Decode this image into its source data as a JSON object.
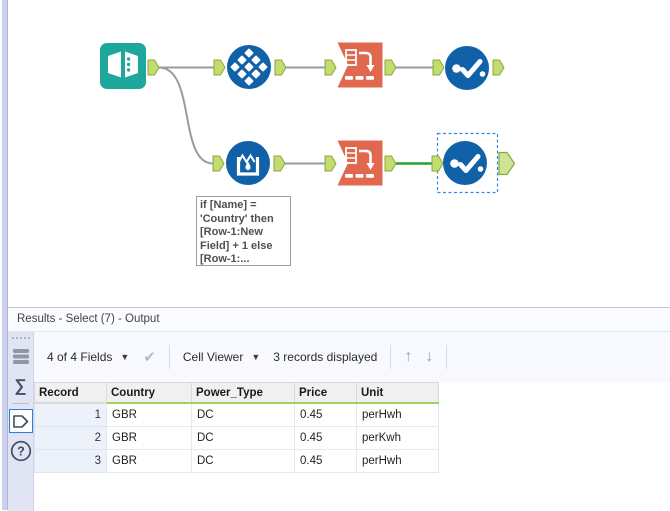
{
  "colors": {
    "tool_blue": "#1161a8",
    "tool_teal": "#1ea79b",
    "tool_orange": "#e0684e",
    "anchor_green": "#c3dc70",
    "anchor_border": "#8aa83e",
    "connection_gray": "#9b9b9b",
    "connection_green_selected": "#2e9e36",
    "selection_dash_blue": "#2f8ae0",
    "header_underline_green": "#9cd45f"
  },
  "icons": {
    "dropdown_caret": "▼",
    "apply_check": "✔",
    "up_arrow": "↑",
    "down_arrow": "↓",
    "sigma": "∑",
    "help": "?"
  },
  "canvas": {
    "tools": [
      {
        "id": "input-data",
        "icon": "open-book-icon",
        "color": "#1ea79b"
      },
      {
        "id": "select",
        "icon": "diamond-grid-icon",
        "color": "#1161a8"
      },
      {
        "id": "transpose-top",
        "icon": "table-rotate-arrow-icon",
        "color": "#e0684e"
      },
      {
        "id": "browse-top",
        "icon": "dot-checkmark-icon",
        "color": "#1161a8"
      },
      {
        "id": "multi-row-formula",
        "icon": "crown-droplet-icon",
        "color": "#1161a8"
      },
      {
        "id": "transpose-bottom",
        "icon": "table-rotate-arrow-icon",
        "color": "#e0684e"
      },
      {
        "id": "browse-bottom",
        "icon": "dot-checkmark-icon",
        "color": "#1161a8",
        "selected": true
      }
    ],
    "annotation_text": "if [Name] =\n'Country' then\n[Row-1:New\nField] + 1 else\n[Row-1:..."
  },
  "results": {
    "title": "Results - Select (7) - Output",
    "toolbar": {
      "fields_dropdown": "4 of 4 Fields",
      "cell_viewer_dropdown": "Cell Viewer",
      "records_displayed": "3 records displayed"
    },
    "table": {
      "columns": [
        "Record",
        "Country",
        "Power_Type",
        "Price",
        "Unit"
      ],
      "rows": [
        [
          "1",
          "GBR",
          "DC",
          "0.45",
          "perHwh"
        ],
        [
          "2",
          "GBR",
          "DC",
          "0.45",
          "perKwh"
        ],
        [
          "3",
          "GBR",
          "DC",
          "0.45",
          "perHwh"
        ]
      ]
    }
  }
}
